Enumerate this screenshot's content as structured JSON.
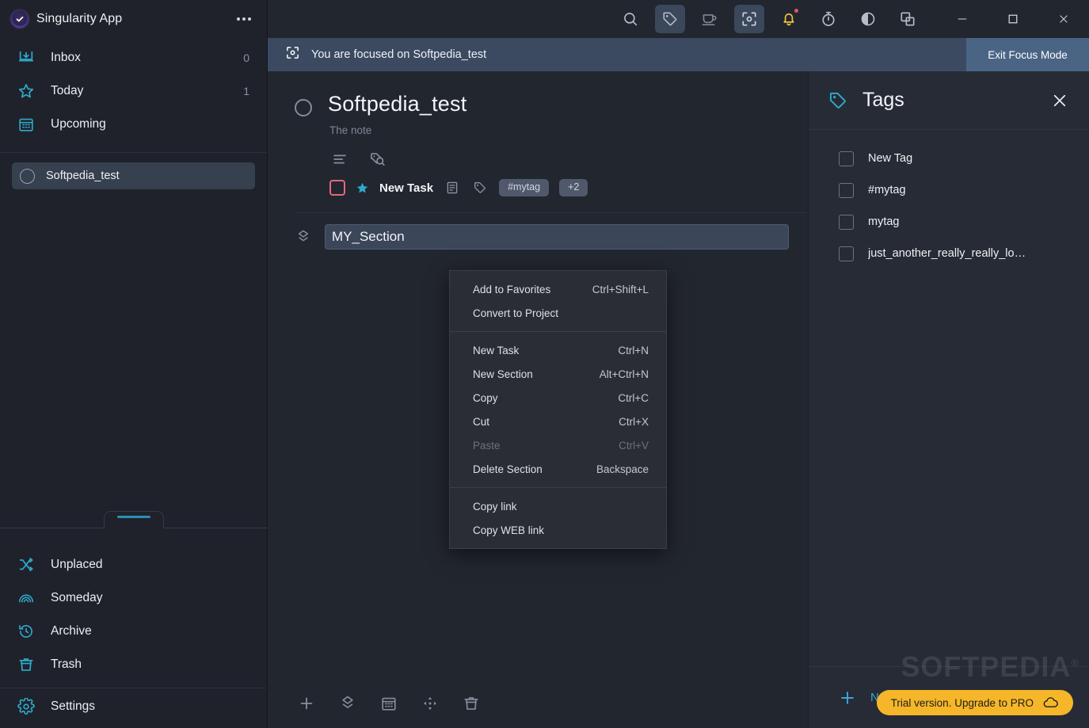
{
  "sidebar": {
    "app_title": "Singularity App",
    "logo_icon": "check-circle-icon",
    "more_icon": "more-options-icon",
    "nav": [
      {
        "label": "Inbox",
        "count": "0",
        "icon": "inbox-icon"
      },
      {
        "label": "Today",
        "count": "1",
        "icon": "star-icon"
      },
      {
        "label": "Upcoming",
        "count": "",
        "icon": "calendar-icon"
      }
    ],
    "projects": [
      {
        "label": "Softpedia_test",
        "selected": true
      }
    ],
    "bottom_nav": [
      {
        "label": "Unplaced",
        "icon": "shuffle-icon"
      },
      {
        "label": "Someday",
        "icon": "rainbow-icon"
      },
      {
        "label": "Archive",
        "icon": "history-icon"
      },
      {
        "label": "Trash",
        "icon": "trash-icon"
      }
    ],
    "settings": {
      "label": "Settings",
      "icon": "gear-icon"
    }
  },
  "toolbar": {
    "icons": [
      {
        "name": "search-icon",
        "active": false
      },
      {
        "name": "tag-icon",
        "active": true
      },
      {
        "name": "coffee-cup-icon",
        "active": false
      },
      {
        "name": "focus-mode-icon",
        "active": true
      },
      {
        "name": "bell-icon",
        "active": false,
        "badge": true
      },
      {
        "name": "timer-icon",
        "active": false
      },
      {
        "name": "theme-contrast-icon",
        "active": false
      },
      {
        "name": "windows-icon",
        "active": false
      }
    ],
    "window_controls": [
      "minimize",
      "maximize",
      "close"
    ]
  },
  "focus_bar": {
    "icon": "focus-mode-icon",
    "message": "You are focused on Softpedia_test",
    "exit_label": "Exit Focus Mode"
  },
  "project": {
    "title": "Softpedia_test",
    "note_placeholder": "The note",
    "tools": [
      {
        "name": "list-view-icon"
      },
      {
        "name": "tag-search-icon"
      }
    ],
    "task": {
      "title": "New Task",
      "star_icon": "star-icon",
      "note_icon": "note-icon",
      "tag_icon": "tag-icon",
      "tags": [
        "#mytag"
      ],
      "more_tags": "+2"
    },
    "section": {
      "icon": "section-layers-icon",
      "value": "MY_Section"
    }
  },
  "content_bottom_bar": [
    {
      "name": "add-icon"
    },
    {
      "name": "section-layers-icon"
    },
    {
      "name": "calendar-icon"
    },
    {
      "name": "move-icon"
    },
    {
      "name": "trash-icon"
    }
  ],
  "context_menu": {
    "groups": [
      [
        {
          "label": "Add to Favorites",
          "shortcut": "Ctrl+Shift+L",
          "disabled": false
        },
        {
          "label": "Convert to Project",
          "shortcut": "",
          "disabled": false
        }
      ],
      [
        {
          "label": "New Task",
          "shortcut": "Ctrl+N",
          "disabled": false
        },
        {
          "label": "New Section",
          "shortcut": "Alt+Ctrl+N",
          "disabled": false
        },
        {
          "label": "Copy",
          "shortcut": "Ctrl+C",
          "disabled": false
        },
        {
          "label": "Cut",
          "shortcut": "Ctrl+X",
          "disabled": false
        },
        {
          "label": "Paste",
          "shortcut": "Ctrl+V",
          "disabled": true
        },
        {
          "label": "Delete Section",
          "shortcut": "Backspace",
          "disabled": false
        }
      ],
      [
        {
          "label": "Copy link",
          "shortcut": "",
          "disabled": false
        },
        {
          "label": "Copy WEB link",
          "shortcut": "",
          "disabled": false
        }
      ]
    ]
  },
  "tags_panel": {
    "title": "Tags",
    "title_icon": "tag-icon",
    "close_icon": "close-icon",
    "items": [
      {
        "label": "New Tag",
        "checked": false
      },
      {
        "label": "#mytag",
        "checked": false
      },
      {
        "label": "mytag",
        "checked": false
      },
      {
        "label": "just_another_really_really_lo…",
        "checked": false
      }
    ],
    "footer": {
      "label": "New Tag",
      "icon": "plus-icon"
    }
  },
  "overlay": {
    "watermark": "SOFTPEDIA",
    "watermark_mark": "®",
    "trial_label": "Trial version. Upgrade to PRO",
    "trial_icon": "cloud-icon"
  },
  "colors": {
    "accent_cyan": "#2fa8c9",
    "sidebar_bg": "#1f222b",
    "content_bg": "#22262f",
    "panel_bg": "#262b35",
    "focus_bar": "#3b4a61",
    "focus_exit": "#4a6484",
    "selected_row": "#36404f",
    "trial_yellow": "#f5b729",
    "task_check_border": "#e2697a",
    "bell_yellow": "#f2c33d",
    "notif_red": "#e8525f"
  }
}
